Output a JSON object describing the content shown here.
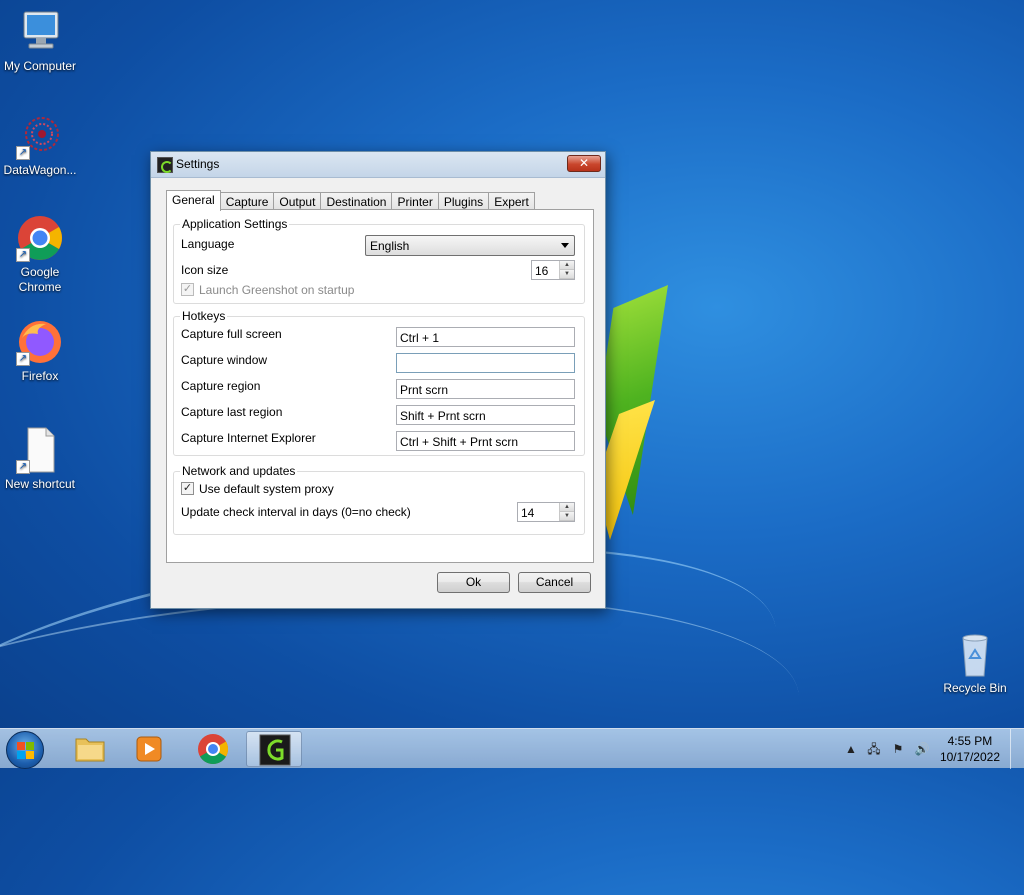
{
  "desktop": {
    "icons": [
      {
        "label": "My Computer",
        "icon": "computer-icon"
      },
      {
        "label": "DataWagon...",
        "icon": "datawagon-icon"
      },
      {
        "label": "Google Chrome",
        "icon": "chrome-icon"
      },
      {
        "label": "Firefox",
        "icon": "firefox-icon"
      },
      {
        "label": "New shortcut",
        "icon": "file-icon"
      },
      {
        "label": "Recycle Bin",
        "icon": "recycle-bin-icon"
      }
    ]
  },
  "window": {
    "title": "Settings",
    "close_glyph": "✕",
    "tabs": [
      "General",
      "Capture",
      "Output",
      "Destination",
      "Printer",
      "Plugins",
      "Expert"
    ],
    "active_tab": "General",
    "app_settings": {
      "group_label": "Application Settings",
      "language_label": "Language",
      "language_value": "English",
      "icon_size_label": "Icon size",
      "icon_size_value": "16",
      "launch_label": "Launch Greenshot on startup",
      "launch_checked": true
    },
    "hotkeys": {
      "group_label": "Hotkeys",
      "rows": [
        {
          "label": "Capture full screen",
          "value": "Ctrl + 1"
        },
        {
          "label": "Capture window",
          "value": ""
        },
        {
          "label": "Capture region",
          "value": "Prnt scrn"
        },
        {
          "label": "Capture last region",
          "value": "Shift + Prnt scrn"
        },
        {
          "label": "Capture Internet Explorer",
          "value": "Ctrl + Shift + Prnt scrn"
        }
      ]
    },
    "network": {
      "group_label": "Network and updates",
      "proxy_label": "Use default system proxy",
      "proxy_checked": true,
      "interval_label": "Update check interval in days (0=no check)",
      "interval_value": "14"
    },
    "ok_label": "Ok",
    "cancel_label": "Cancel"
  },
  "taskbar": {
    "apps": [
      "explorer",
      "media-player",
      "chrome",
      "greenshot"
    ],
    "active_app": "greenshot",
    "time": "4:55 PM",
    "date": "10/17/2022"
  }
}
